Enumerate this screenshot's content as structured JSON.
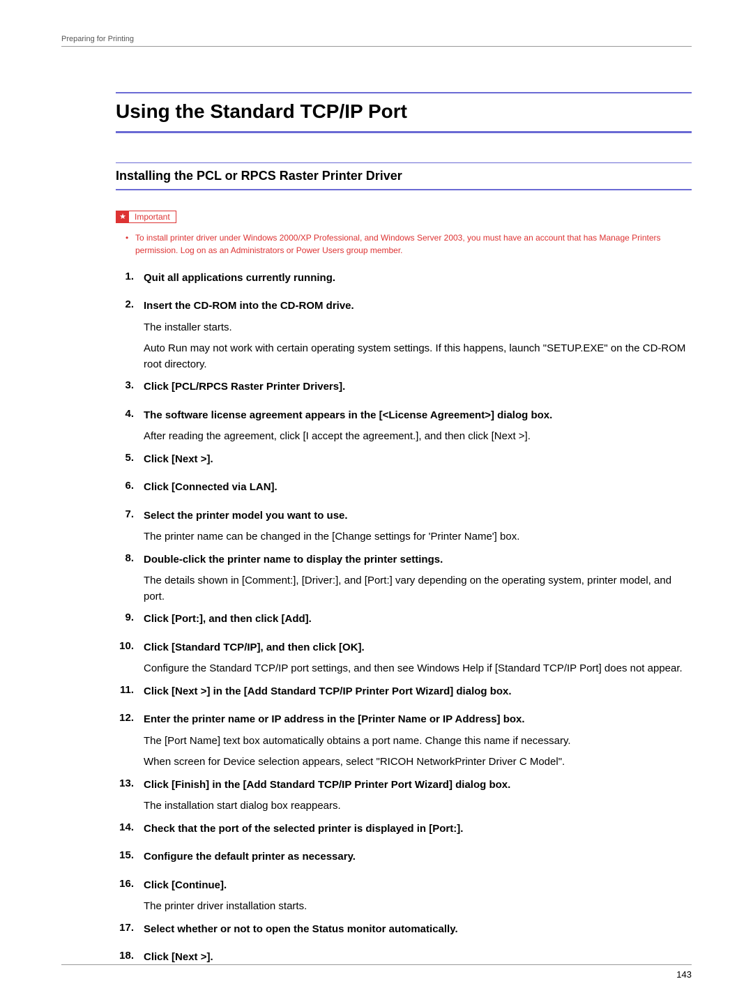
{
  "running_header": "Preparing for Printing",
  "page_title": "Using the Standard TCP/IP Port",
  "section_title": "Installing the PCL or RPCS Raster Printer Driver",
  "important_label": "Important",
  "important_note": "To install printer driver under Windows 2000/XP Professional, and Windows Server 2003, you must have an account that has Manage Printers permission. Log on as an Administrators or Power Users group member.",
  "steps": [
    {
      "n": "1.",
      "title": "Quit all applications currently running.",
      "desc": []
    },
    {
      "n": "2.",
      "title": "Insert the CD-ROM into the CD-ROM drive.",
      "desc": [
        "The installer starts.",
        "Auto Run may not work with certain operating system settings. If this happens, launch \"SETUP.EXE\" on the CD-ROM root directory."
      ]
    },
    {
      "n": "3.",
      "title": "Click [PCL/RPCS Raster Printer Drivers].",
      "desc": []
    },
    {
      "n": "4.",
      "title": "The software license agreement appears in the [<License Agreement>] dialog box.",
      "desc": [
        "After reading the agreement, click [I accept the agreement.], and then click [Next >]."
      ]
    },
    {
      "n": "5.",
      "title": "Click [Next >].",
      "desc": []
    },
    {
      "n": "6.",
      "title": "Click [Connected via LAN].",
      "desc": []
    },
    {
      "n": "7.",
      "title": "Select the printer model you want to use.",
      "desc": [
        "The printer name can be changed in the [Change settings for 'Printer Name'] box."
      ]
    },
    {
      "n": "8.",
      "title": "Double-click the printer name to display the printer settings.",
      "desc": [
        "The details shown in [Comment:], [Driver:], and [Port:] vary depending on the operating system, printer model, and port."
      ]
    },
    {
      "n": "9.",
      "title": "Click [Port:], and then click [Add].",
      "desc": []
    },
    {
      "n": "10.",
      "title": "Click [Standard TCP/IP], and then click [OK].",
      "desc": [
        "Configure the Standard TCP/IP port settings, and then see Windows Help if [Standard TCP/IP Port] does not appear."
      ]
    },
    {
      "n": "11.",
      "title": "Click [Next >] in the [Add Standard TCP/IP Printer Port Wizard] dialog box.",
      "desc": []
    },
    {
      "n": "12.",
      "title": "Enter the printer name or IP address in the [Printer Name or IP Address] box.",
      "desc": [
        "The [Port Name] text box automatically obtains a port name. Change this name if necessary.",
        "When screen for Device selection appears, select \"RICOH NetworkPrinter Driver C Model\"."
      ]
    },
    {
      "n": "13.",
      "title": "Click [Finish] in the [Add Standard TCP/IP Printer Port Wizard] dialog box.",
      "desc": [
        "The installation start dialog box reappears."
      ]
    },
    {
      "n": "14.",
      "title": "Check that the port of the selected printer is displayed in [Port:].",
      "desc": []
    },
    {
      "n": "15.",
      "title": "Configure the default printer as necessary.",
      "desc": []
    },
    {
      "n": "16.",
      "title": "Click [Continue].",
      "desc": [
        "The printer driver installation starts."
      ]
    },
    {
      "n": "17.",
      "title": "Select whether or not to open the Status monitor automatically.",
      "desc": []
    },
    {
      "n": "18.",
      "title": "Click [Next >].",
      "desc": []
    }
  ],
  "page_number": "143"
}
